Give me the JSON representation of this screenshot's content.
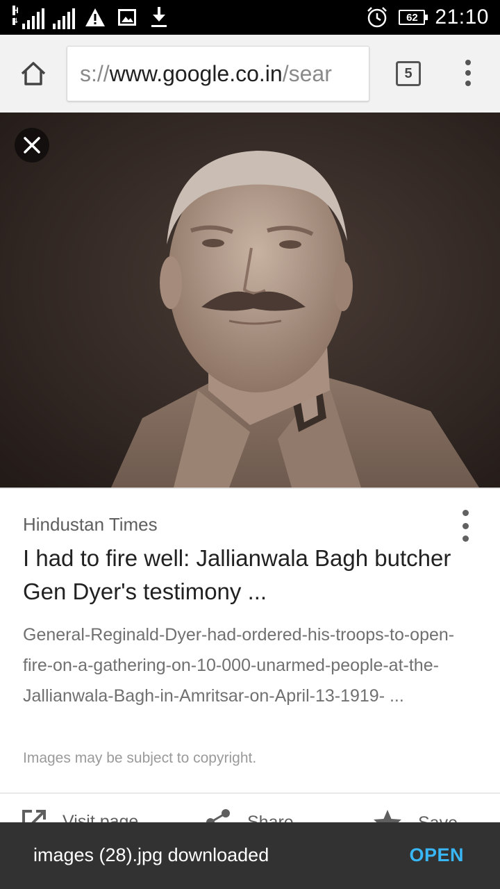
{
  "status_bar": {
    "network_type": "H",
    "battery": "62",
    "time": "21:10",
    "icons": [
      "signal-icon",
      "signal-icon",
      "warning-icon",
      "image-icon",
      "download-icon",
      "alarm-icon",
      "battery-icon"
    ]
  },
  "toolbar": {
    "url_scheme": "s://",
    "url_domain": "www.google.co.in",
    "url_path": "/sear",
    "tab_count": "5"
  },
  "result": {
    "source": "Hindustan Times",
    "title": "I had to fire well: Jallianwala Bagh butcher Gen Dyer's testimony ...",
    "description": "General-Reginald-Dyer-had-ordered-his-troops-to-open-fire-on-a-gathering-on-10-000-unarmed-people-at-the-Jallianwala-Bagh-in-Amritsar-on-April-13-1919- ...",
    "copyright_note": "Images may be subject to copyright.",
    "actions": [
      {
        "label": "Visit page",
        "icon": "open-external-icon"
      },
      {
        "label": "Share",
        "icon": "share-icon"
      },
      {
        "label": "Save",
        "icon": "star-icon"
      }
    ]
  },
  "snackbar": {
    "message": "images (28).jpg downloaded",
    "action": "OPEN"
  },
  "colors": {
    "status_bar": "#000000",
    "toolbar": "#f2f2f2",
    "snackbar": "#323232",
    "snackbar_action": "#38b6f5"
  }
}
